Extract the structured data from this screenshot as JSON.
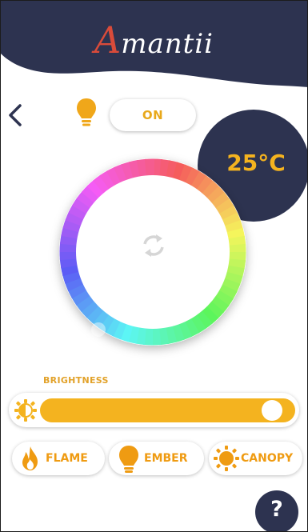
{
  "app": {
    "brand_initial": "A",
    "brand_rest": "mantii"
  },
  "power": {
    "label": "ON"
  },
  "temperature": {
    "value": "25°C"
  },
  "brightness": {
    "label": "BRIGHTNESS",
    "level_fraction": 0.95
  },
  "modes": [
    {
      "label": "FLAME",
      "icon": "flame-icon"
    },
    {
      "label": "EMBER",
      "icon": "lightbulb-icon"
    },
    {
      "label": "CANOPY",
      "icon": "sun-icon"
    }
  ],
  "help": {
    "label": "?"
  },
  "colors": {
    "navy": "#2d3350",
    "accent_amber": "#f4b31f",
    "mode_orange": "#ef9b12",
    "brand_red": "#d94b3a"
  }
}
